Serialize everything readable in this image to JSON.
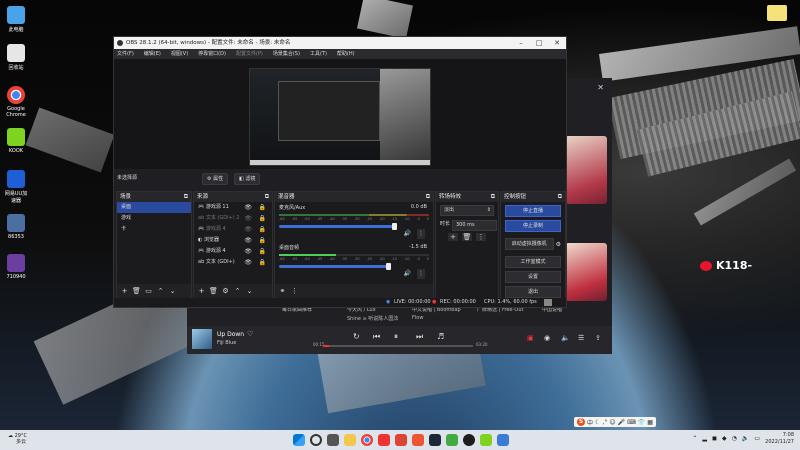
{
  "desktop": {
    "icons": [
      {
        "label": "此电脑",
        "icon": "computer-icon",
        "color": "#4aa3e8"
      },
      {
        "label": "回收站",
        "icon": "recycle-bin-icon",
        "color": "#e6e6e6"
      },
      {
        "label": "Google Chrome",
        "icon": "chrome-icon",
        "color": "#4285f4"
      },
      {
        "label": "KOOK",
        "icon": "kook-icon",
        "color": "#7ed321"
      },
      {
        "label": "网易UU加速器",
        "icon": "uu-icon",
        "color": "#1f5fd6"
      },
      {
        "label": "86353",
        "icon": "app-icon",
        "color": "#4a6fa0"
      },
      {
        "label": "710940",
        "icon": "app-icon",
        "color": "#6a3fa0"
      }
    ],
    "weibo_text": "K118-"
  },
  "obs": {
    "title": "OBS 28.1.2 (64-bit, windows) - 配置文件: 未命名 - 场景: 未命名",
    "menu": [
      "文件(F)",
      "编辑(E)",
      "视图(V)",
      "停靠窗口(D)",
      "配置文件(P)",
      "场景集合(S)",
      "工具(T)",
      "帮助(H)"
    ],
    "source_bar": {
      "label": "未选择源",
      "props": "属性",
      "filters": "滤镜"
    },
    "scenes": {
      "title": "场景",
      "items": [
        "桌面",
        "游戏",
        "卡"
      ],
      "selected": 0
    },
    "sources": {
      "title": "来源",
      "items": [
        {
          "name": "游戏源 11",
          "dim": false
        },
        {
          "name": "文本 (GDI+) 2",
          "dim": true
        },
        {
          "name": "游戏源 4",
          "dim": true
        },
        {
          "name": "浏览器",
          "dim": false
        },
        {
          "name": "游戏源 4",
          "dim": false
        },
        {
          "name": "文本 (GDI+)",
          "dim": false
        }
      ]
    },
    "mixer": {
      "title": "混音器",
      "channels": [
        {
          "name": "麦克风/Aux",
          "db": "0.0 dB"
        },
        {
          "name": "桌面音频",
          "db": "-1.5 dB"
        }
      ],
      "scale": [
        "-60",
        "-55",
        "-50",
        "-45",
        "-40",
        "-35",
        "-30",
        "-25",
        "-20",
        "-15",
        "-10",
        "-5",
        "0"
      ]
    },
    "transitions": {
      "title": "转场特效",
      "type": "淡出",
      "duration_label": "时长",
      "duration": "300 ms"
    },
    "controls": {
      "title": "控制按钮",
      "buttons": [
        "停止直播",
        "停止录制",
        "启动虚拟摄像机",
        "工作室模式",
        "设置",
        "退出"
      ]
    },
    "status": {
      "live": "LIVE: 00:00:00",
      "rec": "REC: 00:00:00",
      "cpu": "CPU: 1.4%, 60.00 fps"
    }
  },
  "music": {
    "rows": [
      {
        "a": "每日歌曲推荐",
        "b": "今天风 / Lux",
        "c": "中文说唱 | Boombap",
        "d": "厂牌精选 | Free-Out",
        "e": "中国说唱"
      },
      {
        "b": "Shine ≥ 听说陈人国法",
        "c": "Flow"
      }
    ],
    "song": "Up Down",
    "artist": "Fiji Blue",
    "time_current": "00:15",
    "time_total": "03:20",
    "progress": 0.04
  },
  "taskbar": {
    "weather_temp": "29°C",
    "weather_desc": "多云",
    "time": "7:08",
    "date": "2022/11/27",
    "tray_lang": "中"
  }
}
